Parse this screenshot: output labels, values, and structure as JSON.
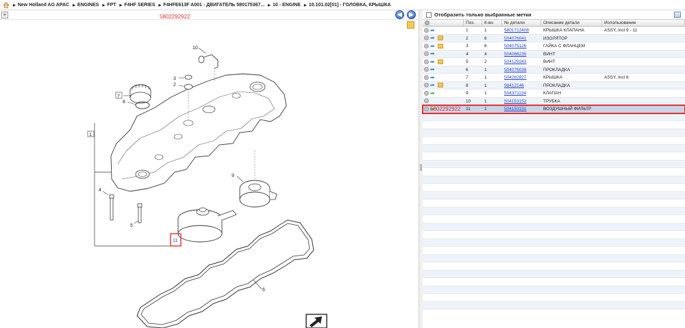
{
  "breadcrumb": {
    "items": [
      "New Holland AG APAC",
      "ENGINES",
      "FPT",
      "F4HF SERIES",
      "F4HFE613F A001 - ДВИГАТЕЛЬ 580175367...",
      "10 - ENGINE",
      "10.101.02[01] - ГОЛОВКА, КРЫШКА"
    ]
  },
  "diagram": {
    "selected_part_number": "5802292922",
    "callouts": [
      "1",
      "2",
      "3",
      "4",
      "5",
      "6",
      "7",
      "8",
      "9",
      "10",
      "11"
    ],
    "highlighted_callout": "11"
  },
  "filter": {
    "label": "Отобразить только выбранные метки"
  },
  "parts_table": {
    "headers": {
      "pos": "Поз.",
      "qty": "К-во",
      "part_no": "№ детали",
      "description": "Описание детали",
      "usage": "Использование"
    },
    "rows": [
      {
        "pos": "1",
        "qty": "1",
        "part_no": "5801712408",
        "description": "КРЫШКА КЛАПАНА",
        "usage": "ASSY, Incl 9 - 11"
      },
      {
        "pos": "2",
        "qty": "6",
        "part_no": "504076041",
        "description": "ИЗОЛЯТОР",
        "usage": ""
      },
      {
        "pos": "3",
        "qty": "6",
        "part_no": "504075126",
        "description": "ГАЙКА С ФЛАНЦЕМ",
        "usage": ""
      },
      {
        "pos": "4",
        "qty": "4",
        "part_no": "504088235",
        "description": "ВИНТ",
        "usage": ""
      },
      {
        "pos": "5",
        "qty": "2",
        "part_no": "504129243",
        "description": "ВИНТ",
        "usage": ""
      },
      {
        "pos": "6",
        "qty": "1",
        "part_no": "504076038",
        "description": "ПРОКЛАДКА",
        "usage": ""
      },
      {
        "pos": "7",
        "qty": "1",
        "part_no": "504262827",
        "description": "КРЫШКА",
        "usage": "ASSY, Incl 8"
      },
      {
        "pos": "8",
        "qty": "1",
        "part_no": "98412146",
        "description": "ПРОКЛАДКА",
        "usage": ""
      },
      {
        "pos": "9",
        "qty": "1",
        "part_no": "504371134",
        "description": "КЛАПАН",
        "usage": ""
      },
      {
        "pos": "10",
        "qty": "1",
        "part_no": "504153152",
        "description": "ТРУБКА",
        "usage": ""
      },
      {
        "pos": "11",
        "qty": "1",
        "part_no": "504153151",
        "description": "ВОЗДУШНЫЙ ФИЛЬТР",
        "usage": ""
      }
    ],
    "selected_row_overlay": "5802292922"
  }
}
